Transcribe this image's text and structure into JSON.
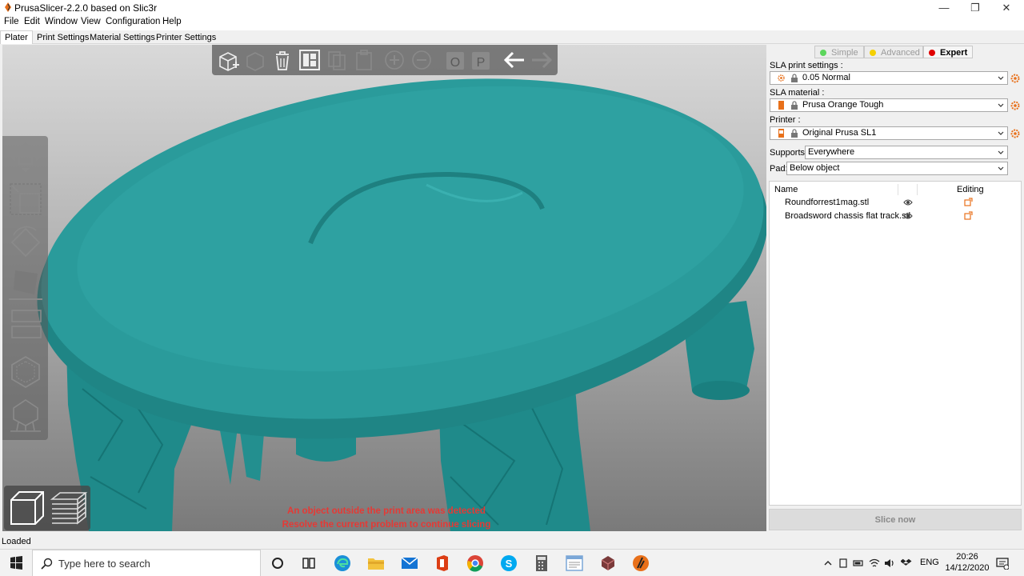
{
  "window": {
    "title": "PrusaSlicer-2.2.0 based on Slic3r",
    "minimize": "—",
    "maximize": "❐",
    "close": "✕"
  },
  "menu": [
    "File",
    "Edit",
    "Window",
    "View",
    "Configuration",
    "Help"
  ],
  "tabs": [
    "Plater",
    "Print Settings",
    "Material Settings",
    "Printer Settings"
  ],
  "active_tab": "Plater",
  "modes": [
    {
      "label": "Simple",
      "color": "#5cd65c"
    },
    {
      "label": "Advanced",
      "color": "#f5d000"
    },
    {
      "label": "Expert",
      "color": "#e00000"
    }
  ],
  "active_mode": "Expert",
  "sidebar": {
    "print_label": "SLA print settings :",
    "print_value": "0.05 Normal",
    "material_label": "SLA material :",
    "material_value": "Prusa Orange Tough",
    "material_color": "#e8701a",
    "printer_label": "Printer :",
    "printer_value": "Original Prusa SL1",
    "supports_label": "Supports:",
    "supports_value": "Everywhere",
    "pad_label": "Pad:",
    "pad_value": "Below object"
  },
  "object_list": {
    "header_name": "Name",
    "header_editing": "Editing",
    "objects": [
      {
        "name": "Roundforrest1mag.stl"
      },
      {
        "name": "Broadsword chassis flat track.stl"
      }
    ]
  },
  "slice_button": "Slice now",
  "viewport": {
    "warning_line1": "An object outside the print area was detected",
    "warning_line2": "Resolve the current problem to continue slicing",
    "model_color": "#2a9a9a"
  },
  "status": "Loaded",
  "taskbar": {
    "search_placeholder": "Type here to search",
    "language": "ENG",
    "time": "20:26",
    "date": "14/12/2020"
  }
}
